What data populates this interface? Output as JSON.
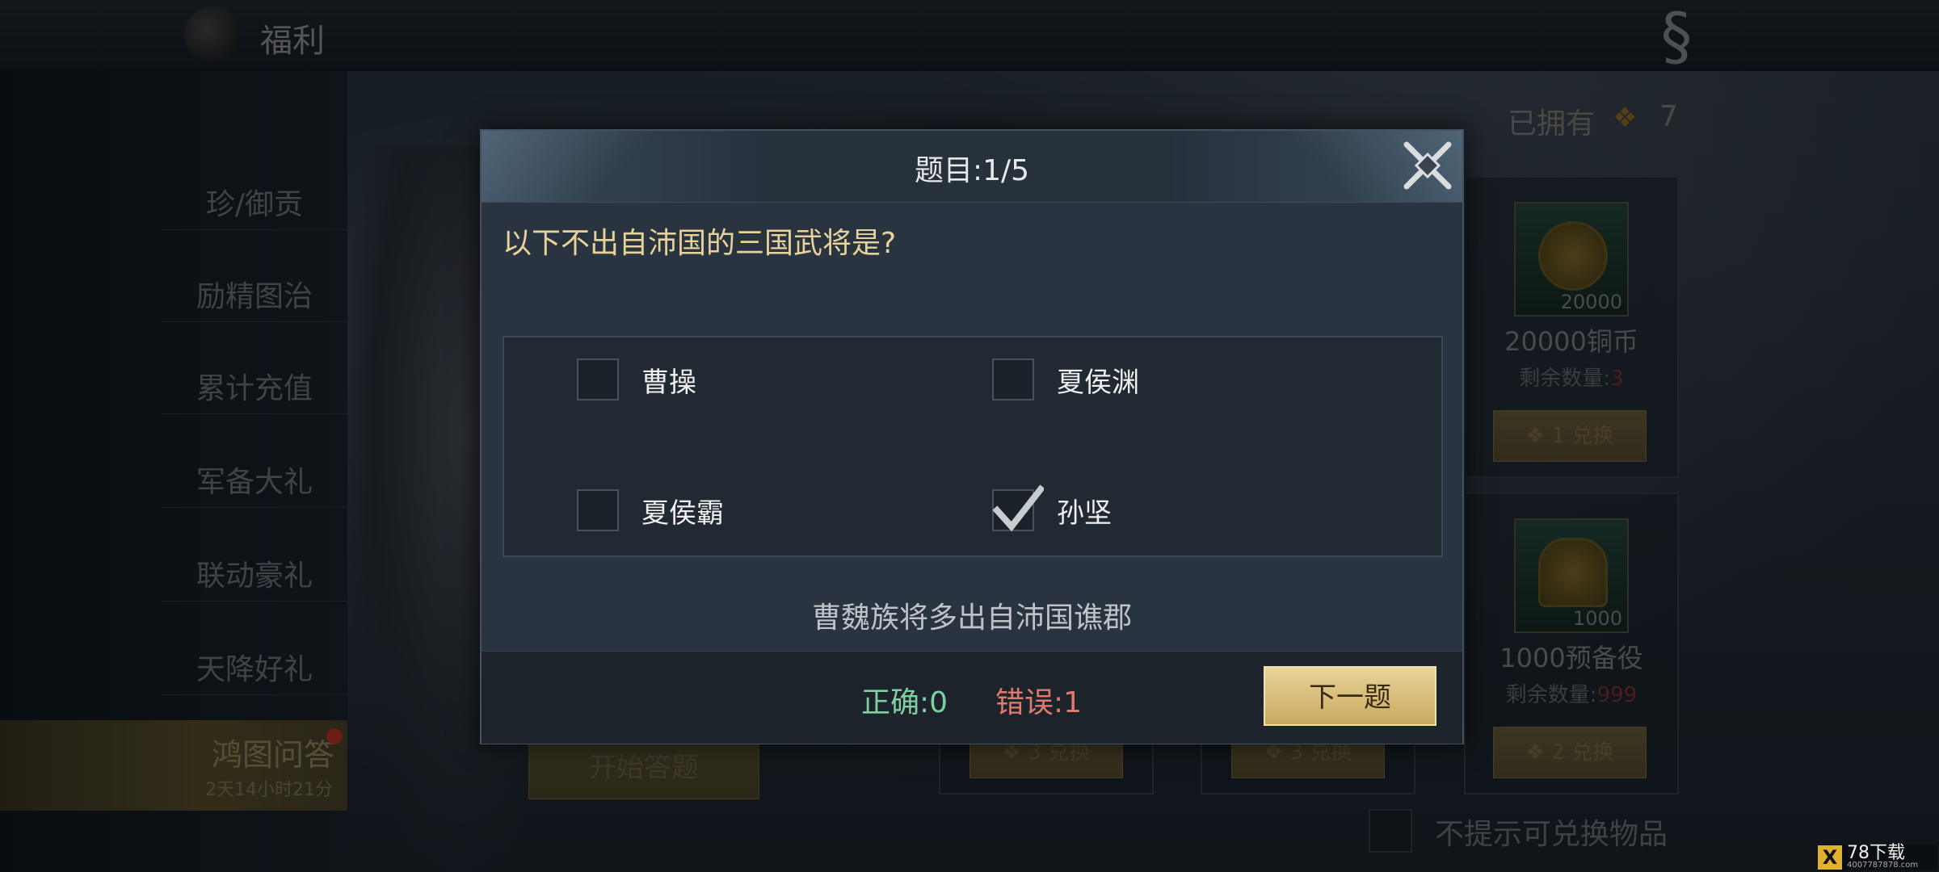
{
  "topbar": {
    "title": "福利"
  },
  "nav": {
    "items": [
      {
        "label": "珍/御贡"
      },
      {
        "label": "励精图治"
      },
      {
        "label": "累计充值"
      },
      {
        "label": "军备大礼"
      },
      {
        "label": "联动豪礼"
      },
      {
        "label": "天降好礼"
      }
    ],
    "active": {
      "label": "鸿图问答",
      "countdown": "2天14小时21分"
    }
  },
  "shop": {
    "owned_label": "已拥有",
    "owned_count": "7",
    "cards": [
      {
        "qty": "20000",
        "name": "20000铜币",
        "remain_label": "剩余数量:",
        "remain": "3",
        "cost": "1",
        "btn": "兑换"
      },
      {
        "qty": "1000",
        "name": "1000预备役",
        "remain_label": "剩余数量:",
        "remain": "999",
        "cost": "2",
        "btn": "兑换"
      }
    ],
    "bottom_buttons": [
      {
        "cost": "3",
        "btn": "兑换"
      },
      {
        "cost": "3",
        "btn": "兑换"
      }
    ],
    "start_label": "开始答题",
    "hide_label": "不提示可兑换物品"
  },
  "dialog": {
    "title": "题目:1/5",
    "question": "以下不出自沛国的三国武将是?",
    "options": [
      {
        "label": "曹操",
        "checked": false
      },
      {
        "label": "夏侯渊",
        "checked": false
      },
      {
        "label": "夏侯霸",
        "checked": false
      },
      {
        "label": "孙坚",
        "checked": true
      }
    ],
    "hint": "曹魏族将多出自沛国谯郡",
    "correct": "正确:0",
    "wrong": "错误:1",
    "next_label": "下一题"
  },
  "watermark": {
    "brand": "78下载",
    "url": "4007787878.com"
  },
  "colors": {
    "accent_gold": "#c9a95f",
    "correct_green": "#7fd0a0",
    "wrong_red": "#e07a6e",
    "question_yellow": "#e7d39a"
  }
}
